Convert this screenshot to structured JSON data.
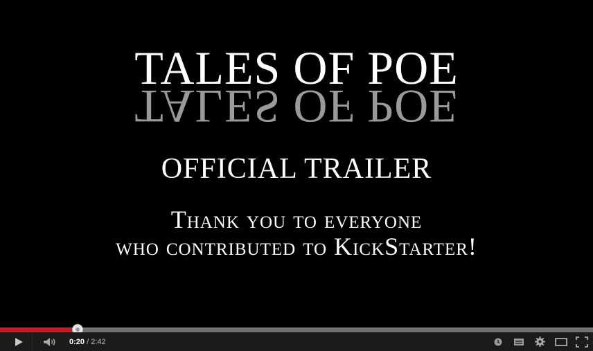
{
  "video": {
    "title_line": "TALES OF POE",
    "subtitle": "OFFICIAL TRAILER",
    "thanks_line1": "Thank you to everyone",
    "thanks_line2": "who contributed to KickStarter!"
  },
  "player": {
    "current_time": "0:20",
    "separator": "/",
    "duration": "2:42",
    "progress": 0.1235,
    "accent_color": "#cc181e"
  },
  "icons": {
    "play": "play-icon",
    "volume": "volume-icon",
    "watch_later": "clock-icon",
    "captions": "captions-icon",
    "settings": "gear-icon",
    "theater": "theater-mode-icon",
    "fullscreen": "fullscreen-icon"
  }
}
